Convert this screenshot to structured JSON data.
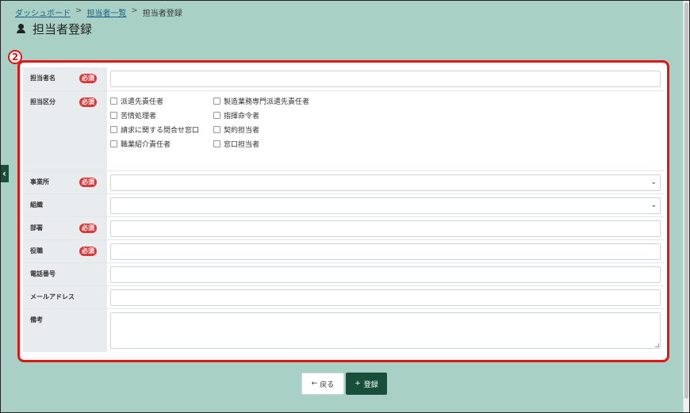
{
  "breadcrumb": {
    "items": [
      "ダッシュボード",
      "担当者一覧",
      "担当者登録"
    ],
    "separator": ">"
  },
  "page": {
    "title": "担当者登録"
  },
  "marker": {
    "label": "2"
  },
  "form": {
    "required_label": "必須",
    "rows": {
      "name": {
        "label": "担当者名"
      },
      "category": {
        "label": "担当区分",
        "options": [
          "派遣先責任者",
          "製造業務専門派遣先責任者",
          "苦情処理者",
          "指揮命令者",
          "請求に関する問合せ窓口",
          "契約担当者",
          "職業紹介責任者",
          "窓口担当者"
        ]
      },
      "office": {
        "label": "事業所"
      },
      "organization": {
        "label": "組織"
      },
      "department": {
        "label": "部署"
      },
      "position": {
        "label": "役職"
      },
      "phone": {
        "label": "電話番号"
      },
      "email": {
        "label": "メールアドレス"
      },
      "notes": {
        "label": "備考"
      }
    }
  },
  "buttons": {
    "back": "戻る",
    "register": "登録"
  }
}
